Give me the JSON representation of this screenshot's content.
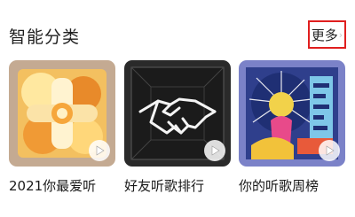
{
  "section": {
    "title": "智能分类",
    "more_label": "更多",
    "more_caret": "›"
  },
  "playlists": [
    {
      "caption": "2021你最爱听",
      "icon": "play-icon"
    },
    {
      "caption": "好友听歌排行",
      "icon": "play-icon"
    },
    {
      "caption": "你的听歌周榜",
      "icon": "play-icon"
    }
  ],
  "colors": {
    "accent_border": "#e01f1f"
  }
}
